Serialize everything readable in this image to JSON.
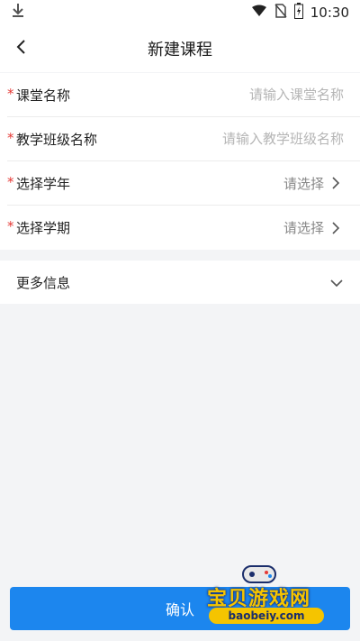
{
  "status_bar": {
    "time": "10:30"
  },
  "header": {
    "title": "新建课程"
  },
  "form": {
    "required_mark": "*",
    "course_name": {
      "label": "课堂名称",
      "placeholder": "请输入课堂名称"
    },
    "class_name": {
      "label": "教学班级名称",
      "placeholder": "请输入教学班级名称"
    },
    "school_year": {
      "label": "选择学年",
      "value": "请选择"
    },
    "semester": {
      "label": "选择学期",
      "value": "请选择"
    }
  },
  "more_info": {
    "label": "更多信息"
  },
  "confirm": {
    "label": "确认"
  },
  "watermark": {
    "title": "宝贝游戏网",
    "url": "baobeiy.com"
  },
  "colors": {
    "primary": "#1c86ee",
    "required": "#e53935",
    "background": "#f3f4f6"
  },
  "icons": [
    "download-icon",
    "wifi-icon",
    "no-sim-icon",
    "battery-icon",
    "back-arrow-icon",
    "chevron-right-icon",
    "chevron-down-icon"
  ]
}
